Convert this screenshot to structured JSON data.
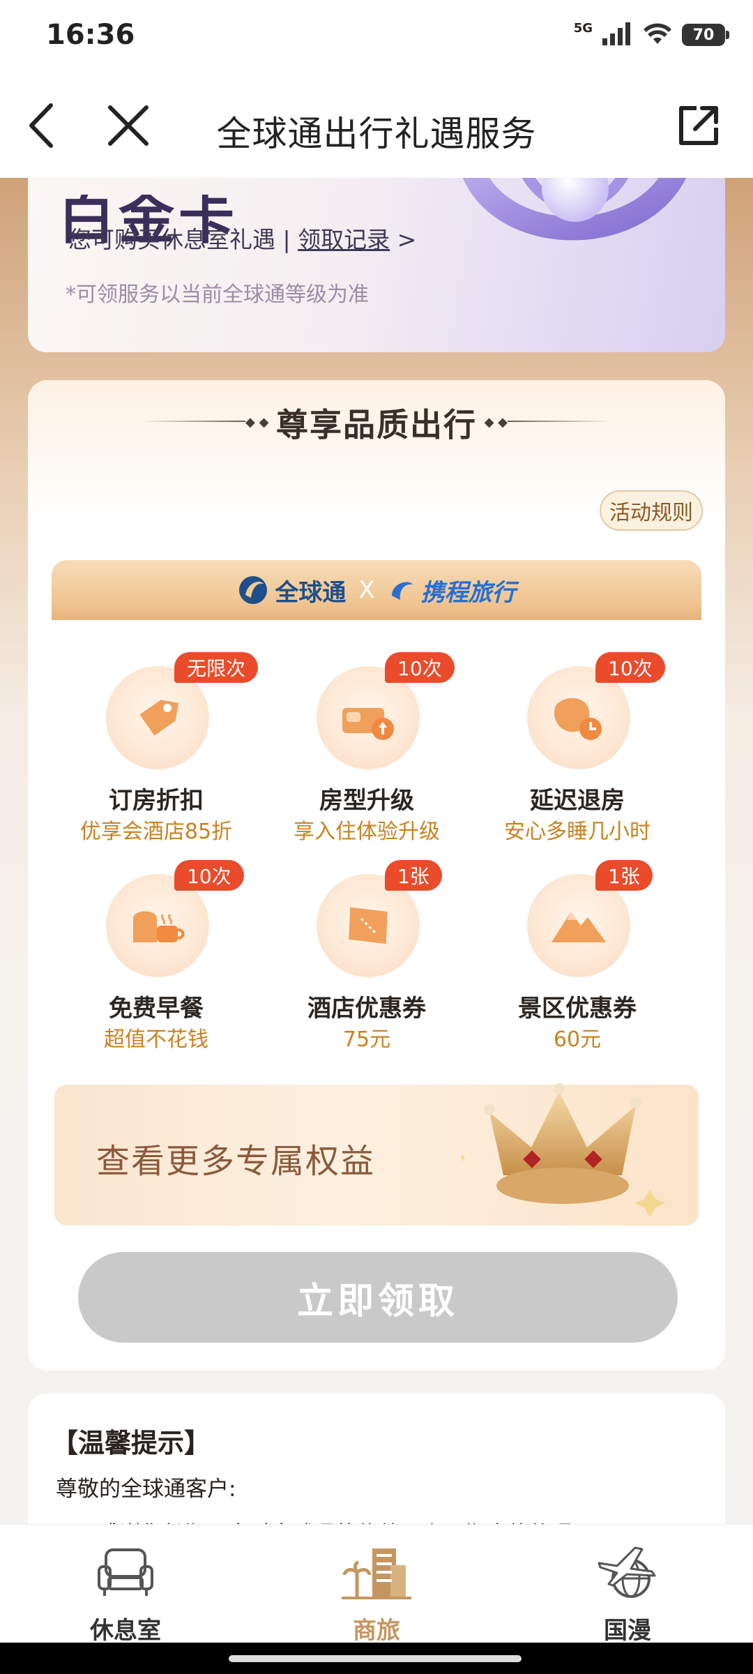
{
  "status_bar": {
    "time": "16:36",
    "network": "5G",
    "battery": "70"
  },
  "header": {
    "title": "全球通出行礼遇服务"
  },
  "top_card": {
    "partial_heading": "白金卡",
    "lounge_text": "您可购买休息室礼遇 | ",
    "lounge_link": "领取记录",
    "lounge_arrow": ">",
    "note": "*可领服务以当前全球通等级为准"
  },
  "main_card": {
    "section_title": "尊享品质出行",
    "rule_button": "活动规则",
    "partner_left": "全球通",
    "partner_x": "X",
    "partner_right": "携程旅行",
    "benefits": [
      {
        "badge": "无限次",
        "title": "订房折扣",
        "subtitle": "优享会酒店85折",
        "icon": "tag-icon"
      },
      {
        "badge": "10次",
        "title": "房型升级",
        "subtitle": "享入住体验升级",
        "icon": "bed-upgrade-icon"
      },
      {
        "badge": "10次",
        "title": "延迟退房",
        "subtitle": "安心多睡几小时",
        "icon": "late-checkout-icon"
      },
      {
        "badge": "10次",
        "title": "免费早餐",
        "subtitle": "超值不花钱",
        "icon": "breakfast-icon"
      },
      {
        "badge": "1张",
        "title": "酒店优惠券",
        "subtitle": "75元",
        "icon": "ticket-icon"
      },
      {
        "badge": "1张",
        "title": "景区优惠券",
        "subtitle": "60元",
        "icon": "mountain-icon"
      }
    ],
    "more_benefits": "查看更多专属权益",
    "claim_button": "立即领取"
  },
  "tips": {
    "title": "【温馨提示】",
    "greeting": "尊敬的全球通客户:",
    "body": "感谢您长期以来对全球通的信赖，上一期商旅礼遇已于2026"
  },
  "bottom_nav": {
    "items": [
      {
        "label": "休息室",
        "icon": "armchair-icon"
      },
      {
        "label": "商旅",
        "icon": "city-palm-icon"
      },
      {
        "label": "国漫",
        "icon": "globe-plane-icon"
      }
    ]
  },
  "colors": {
    "accent_orange": "#ea4b2b",
    "gold_text": "#c8821f",
    "active_nav": "#c49761",
    "disabled_button": "#c9c9c9"
  }
}
